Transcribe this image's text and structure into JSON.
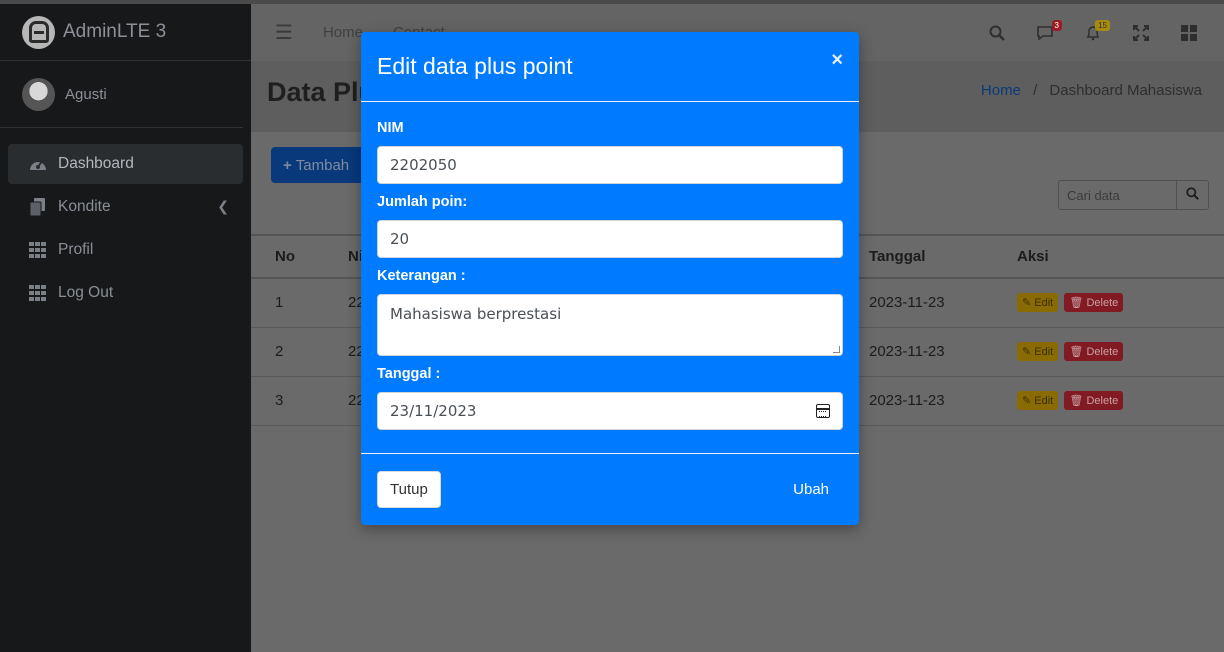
{
  "brand": {
    "name": "AdminLTE 3"
  },
  "user": {
    "name": "Agusti"
  },
  "sidebar": {
    "items": [
      {
        "label": "Dashboard",
        "icon": "gauge-icon",
        "active": true
      },
      {
        "label": "Kondite",
        "icon": "copy-icon"
      },
      {
        "label": "Profil",
        "icon": "grid-icon"
      },
      {
        "label": "Log Out",
        "icon": "grid-icon"
      }
    ]
  },
  "topbar": {
    "links": [
      "Home",
      "Contact"
    ],
    "messages_badge": "3",
    "notifications_badge": "15"
  },
  "page": {
    "title": "Data Plu",
    "breadcrumb": {
      "home": "Home",
      "sep": "/",
      "current": "Dashboard Mahasiswa"
    }
  },
  "toolbar": {
    "add_label": "Tambah",
    "search_placeholder": "Cari data"
  },
  "table": {
    "headers": [
      "No",
      "Ni",
      "Tanggal",
      "Aksi"
    ],
    "rows": [
      {
        "no": "1",
        "nim": "22",
        "tanggal": "2023-11-23"
      },
      {
        "no": "2",
        "nim": "22",
        "tanggal": "2023-11-23"
      },
      {
        "no": "3",
        "nim": "22",
        "tanggal": "2023-11-23"
      }
    ],
    "edit_label": "Edit",
    "delete_label": "Delete"
  },
  "modal": {
    "title": "Edit data plus point",
    "close_symbol": "×",
    "fields": {
      "nim": {
        "label": "NIM",
        "value": "2202050"
      },
      "poin": {
        "label": "Jumlah poin:",
        "value": "20"
      },
      "keterangan": {
        "label": "Keterangan :",
        "value": "Mahasiswa berprestasi"
      },
      "tanggal": {
        "label": "Tanggal :",
        "value": "23/11/2023"
      }
    },
    "close_label": "Tutup",
    "save_label": "Ubah"
  },
  "colors": {
    "primary": "#007bff",
    "sidebar": "#16181a",
    "warning": "#ffc107",
    "danger": "#dc3545"
  }
}
